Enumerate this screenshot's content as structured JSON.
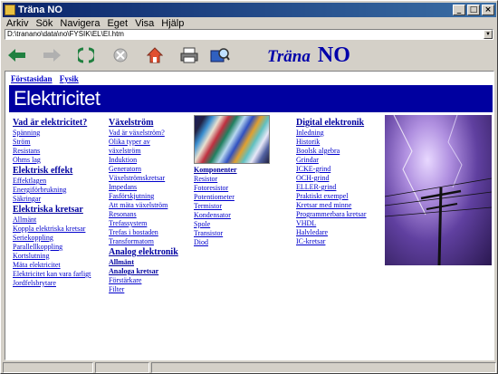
{
  "window": {
    "title": "Träna NO"
  },
  "title_buttons": [
    "_",
    "□",
    "×"
  ],
  "menu": [
    "Arkiv",
    "Sök",
    "Navigera",
    "Eget",
    "Visa",
    "Hjälp"
  ],
  "address": {
    "value": "D:\\tranano\\data\\no\\FYSIK\\EL\\EI.htm"
  },
  "toolbar": {
    "icons": [
      "back-arrow-icon",
      "forward-arrow-icon",
      "refresh-icon",
      "stop-icon",
      "home-icon",
      "print-icon",
      "search-book-icon"
    ],
    "brand_text": "Träna",
    "brand_no": "NO"
  },
  "breadcrumbs": [
    "Förstasidan",
    "Fysik"
  ],
  "banner": "Elektricitet",
  "col1": {
    "h1": "Vad är elektricitet?",
    "l1": [
      "Spänning",
      "Ström",
      "Resistans",
      "Ohms lag"
    ],
    "h2": "Elektrisk effekt",
    "l2": [
      "Effektlagen",
      "Energiförbrukning",
      "Säkringar"
    ],
    "h3": "Elektriska kretsar",
    "l3": [
      "Allmänt",
      "Koppla elektriska kretsar",
      "Seriekoppling",
      "Parallellkoppling",
      "Kortslutning",
      "Mäta elektricitet",
      "Elektricitet kan vara farligt",
      "Jordfelsbrytare"
    ]
  },
  "col2": {
    "h1": "Växelström",
    "l1": [
      "Vad är växelström?",
      "Olika typer av",
      "växelström",
      "Induktion",
      "Generatorn",
      "Växelströmskretsar",
      "Impedans",
      "Fasförskjutning",
      "Att mäta växelström",
      "Resonans",
      "Trefassystem",
      "Trefas i bostaden",
      "Transformatorn"
    ],
    "h2": "Analog elektronik",
    "sh1": "Allmänt",
    "sh2": "Analoga kretsar",
    "l2": [
      "Förstärkare",
      "Filter"
    ]
  },
  "col3": {
    "sh": "Komponenter",
    "l": [
      "Resistor",
      "Fotoresistor",
      "Potentiometer",
      "Termistor",
      "Kondensator",
      "Spole",
      "Transistor",
      "Diod"
    ]
  },
  "col4": {
    "h1": "Digital elektronik",
    "l": [
      "Inledning",
      "Historik",
      "Boolsk algebra",
      "Grindar",
      "ICKE-grind",
      "OCH-grind",
      "ELLER-grind",
      "Praktiskt exempel",
      "Kretsar med minne",
      "Programmerbara kretsar",
      "VHDL",
      "Halvledare",
      "IC-kretsar"
    ]
  }
}
